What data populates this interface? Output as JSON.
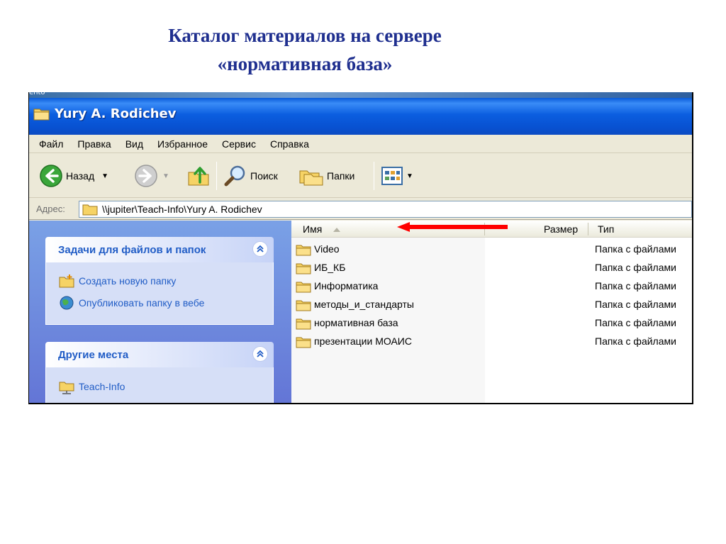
{
  "slide": {
    "title_line1": "Каталог материалов на сервере",
    "title_line2": "«нормативная база»"
  },
  "window": {
    "desktop_label": "ento",
    "title": "Yury A. Rodichev",
    "menu": [
      "Файл",
      "Правка",
      "Вид",
      "Избранное",
      "Сервис",
      "Справка"
    ],
    "toolbar": {
      "back_label": "Назад",
      "search_label": "Поиск",
      "folders_label": "Папки"
    },
    "address": {
      "label": "Адрес:",
      "path": "\\\\jupiter\\Teach-Info\\Yury A. Rodichev"
    }
  },
  "taskpane": {
    "file_tasks": {
      "title": "Задачи для файлов и папок",
      "items": [
        "Создать новую папку",
        "Опубликовать папку в вебе"
      ]
    },
    "other_places": {
      "title": "Другие места",
      "items": [
        "Teach-Info"
      ]
    }
  },
  "file_list": {
    "columns": {
      "name": "Имя",
      "size": "Размер",
      "type": "Тип"
    },
    "rows": [
      {
        "name": "Video",
        "type": "Папка с файлами"
      },
      {
        "name": "ИБ_КБ",
        "type": "Папка с файлами"
      },
      {
        "name": "Информатика",
        "type": "Папка с файлами"
      },
      {
        "name": "методы_и_стандарты",
        "type": "Папка с файлами"
      },
      {
        "name": "нормативная база",
        "type": "Папка с файлами"
      },
      {
        "name": "презентации МОАИС",
        "type": "Папка с файлами"
      }
    ]
  },
  "colors": {
    "title_blue": "#1f2f8f",
    "xp_title_blue": "#0b5ee0",
    "task_link_blue": "#215dc6",
    "arrow_red": "#ff0000",
    "folder_yellow": "#f6d365"
  },
  "icons": {
    "back": "back-arrow-icon",
    "forward": "forward-arrow-icon",
    "up": "folder-up-icon",
    "search": "magnifier-icon",
    "folders": "folders-icon",
    "views": "views-icon",
    "folder": "folder-icon",
    "new_folder": "new-folder-icon",
    "publish": "globe-icon",
    "network": "network-folder-icon",
    "collapse": "chevron-up-icon"
  }
}
